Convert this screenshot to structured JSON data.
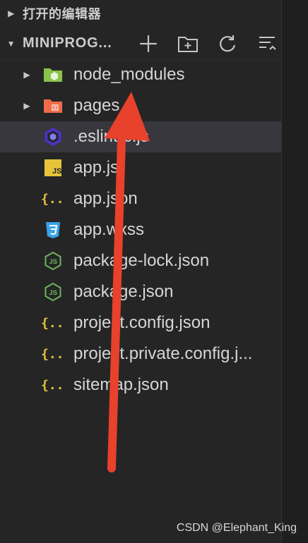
{
  "open_editors": {
    "label": "打开的编辑器"
  },
  "project": {
    "name": "MINIPROG...",
    "toolbar": {
      "new_file_icon": "plus-icon",
      "new_folder_icon": "folder-plus-icon",
      "refresh_icon": "refresh-icon",
      "collapse_icon": "collapse-icon"
    }
  },
  "files": [
    {
      "label": "node_modules",
      "type": "folder",
      "icon": "node-modules-folder-icon",
      "expandable": true,
      "selected": false
    },
    {
      "label": "pages",
      "type": "folder",
      "icon": "pages-folder-icon",
      "expandable": true,
      "selected": false
    },
    {
      "label": ".eslintrc.js",
      "type": "file",
      "icon": "eslint-icon",
      "expandable": false,
      "selected": true
    },
    {
      "label": "app.js",
      "type": "file",
      "icon": "js-icon",
      "expandable": false,
      "selected": false
    },
    {
      "label": "app.json",
      "type": "file",
      "icon": "json-icon",
      "expandable": false,
      "selected": false
    },
    {
      "label": "app.wxss",
      "type": "file",
      "icon": "css-icon",
      "expandable": false,
      "selected": false
    },
    {
      "label": "package-lock.json",
      "type": "file",
      "icon": "node-json-icon",
      "expandable": false,
      "selected": false
    },
    {
      "label": "package.json",
      "type": "file",
      "icon": "node-json-icon",
      "expandable": false,
      "selected": false
    },
    {
      "label": "project.config.json",
      "type": "file",
      "icon": "json-icon",
      "expandable": false,
      "selected": false
    },
    {
      "label": "project.private.config.j...",
      "type": "file",
      "icon": "json-icon",
      "expandable": false,
      "selected": false
    },
    {
      "label": "sitemap.json",
      "type": "file",
      "icon": "json-icon",
      "expandable": false,
      "selected": false
    }
  ],
  "watermark": "CSDN @Elephant_King",
  "colors": {
    "background": "#252526",
    "selected_row": "#37373d",
    "annotation_arrow": "#e8412c",
    "js_yellow": "#e8c33a",
    "json_yellow": "#e8c33a",
    "css_blue": "#3aa3e8",
    "node_green": "#6fb35a",
    "folder_green": "#8bc34a",
    "folder_orange": "#ef6c4a",
    "eslint_purple": "#4b32c3"
  }
}
